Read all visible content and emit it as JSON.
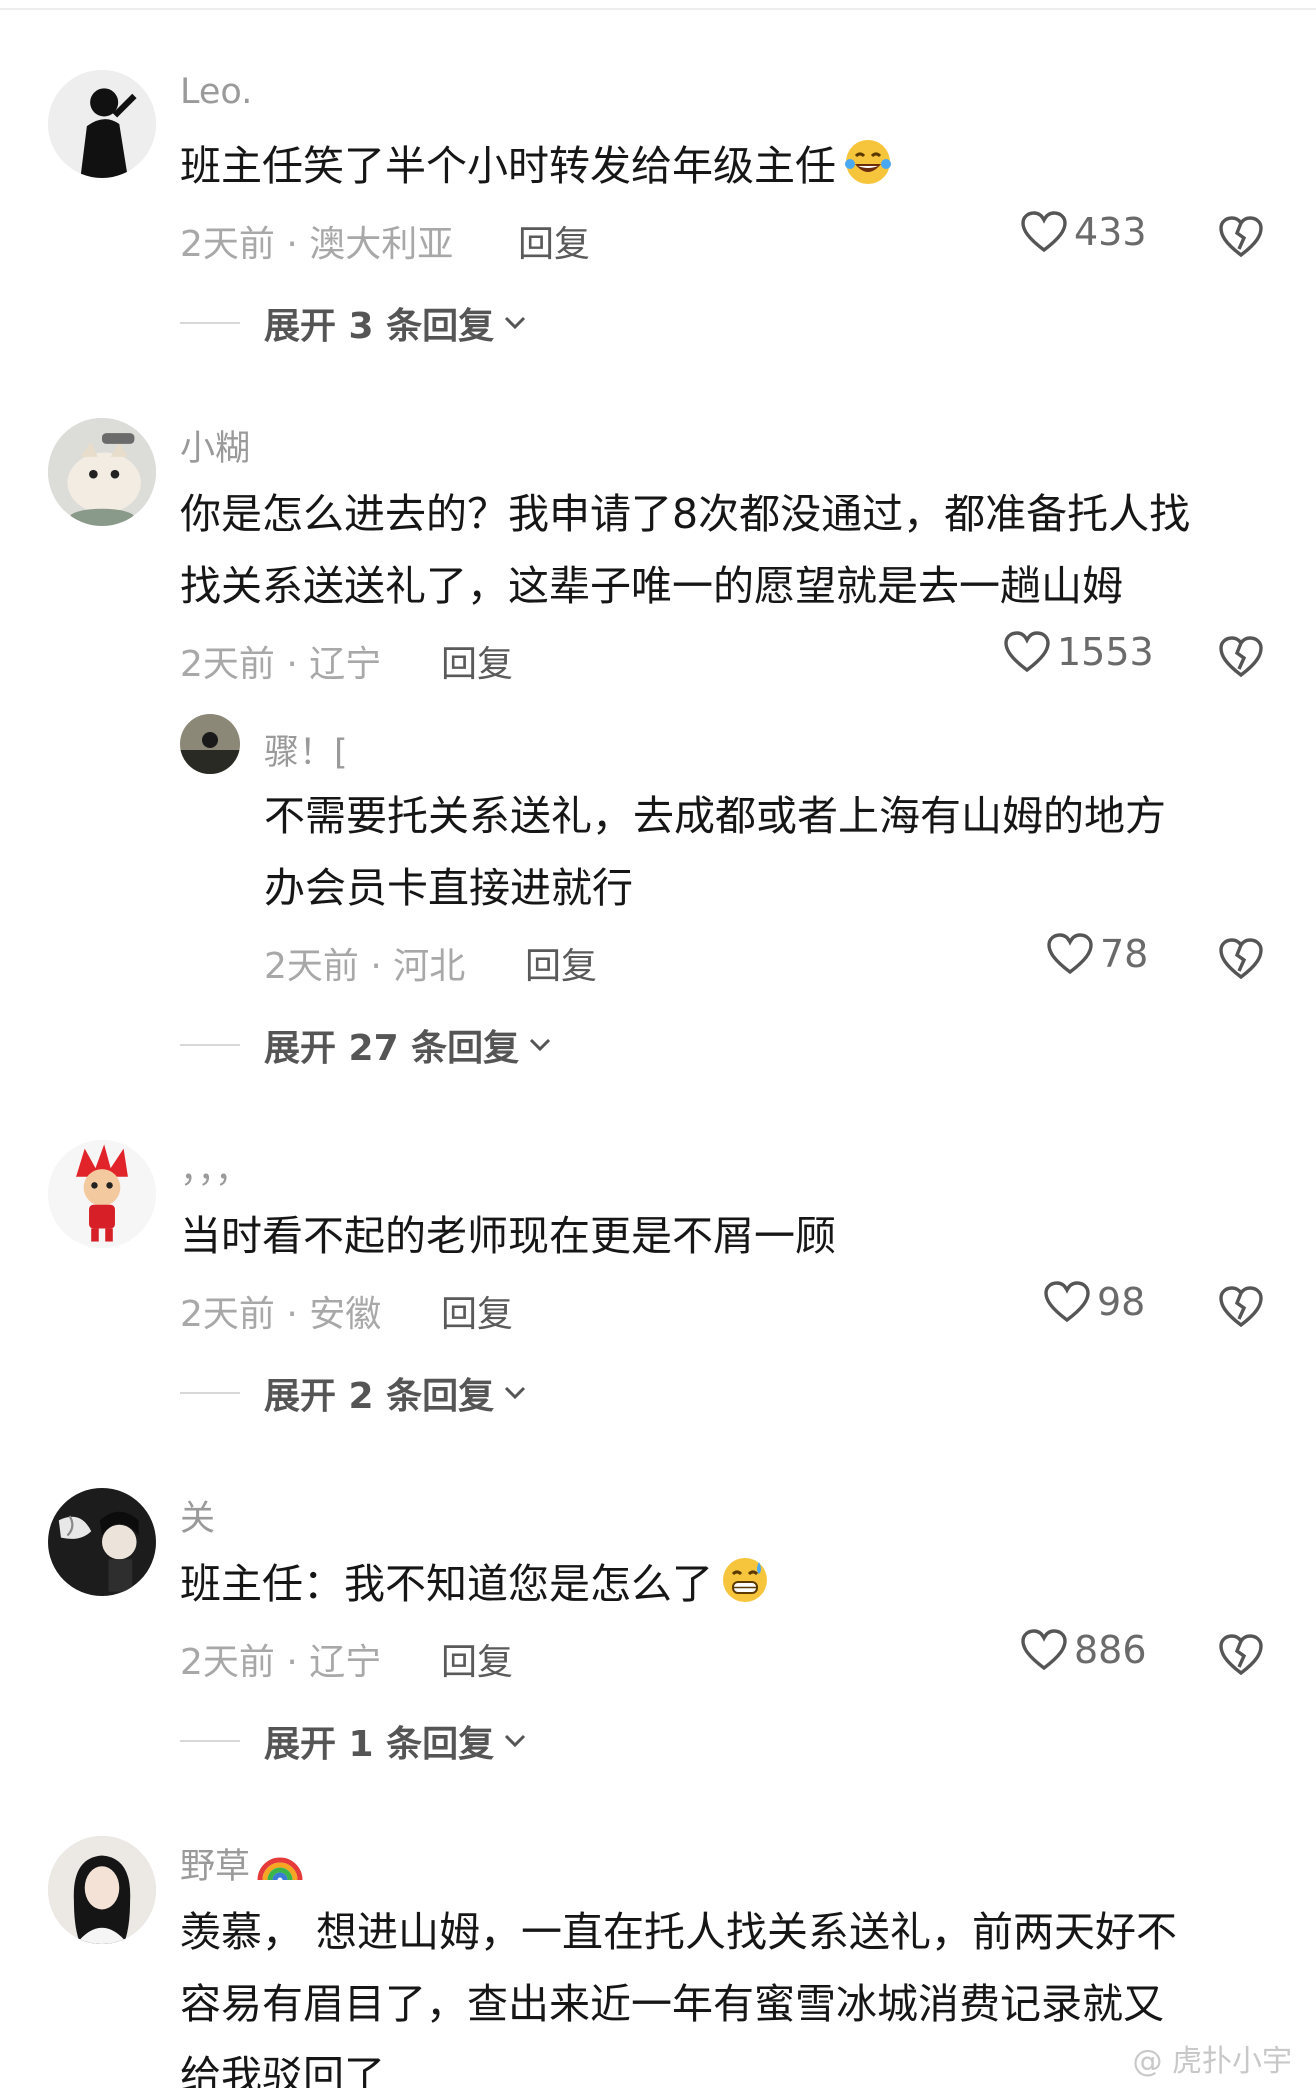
{
  "comments": [
    {
      "username": "Leo.",
      "content_lines": [
        "班主任笑了半个小时转发给年级主任"
      ],
      "emoji": "face-with-tears-of-joy",
      "time_location": "2天前 · 澳大利亚",
      "reply_label": "回复",
      "likes": "433",
      "expand_label": "展开 3 条回复"
    },
    {
      "username": "小糊",
      "content_lines": [
        "你是怎么进去的？我申请了8次都没通过，都准备托人找",
        "找关系送送礼了，这辈子唯一的愿望就是去一趟山姆"
      ],
      "time_location": "2天前 · 辽宁",
      "reply_label": "回复",
      "likes": "1553",
      "sub_reply": {
        "username": "骤！[",
        "content_lines": [
          "不需要托关系送礼，去成都或者上海有山姆的地方",
          "办会员卡直接进就行"
        ],
        "time_location": "2天前 · 河北",
        "reply_label": "回复",
        "likes": "78"
      },
      "expand_label": "展开 27 条回复"
    },
    {
      "username": "，，，",
      "content_lines": [
        "当时看不起的老师现在更是不屑一顾"
      ],
      "time_location": "2天前 · 安徽",
      "reply_label": "回复",
      "likes": "98",
      "expand_label": "展开 2 条回复"
    },
    {
      "username": "关",
      "content_lines": [
        "班主任：我不知道您是怎么了"
      ],
      "emoji": "grinning-face-with-sweat",
      "time_location": "2天前 · 辽宁",
      "reply_label": "回复",
      "likes": "886",
      "expand_label": "展开 1 条回复"
    },
    {
      "username": "野草",
      "username_emoji": "rainbow",
      "content_lines": [
        "羡慕， 想进山姆，一直在托人找关系送礼，前两天好不",
        "容易有眉目了，查出来近一年有蜜雪冰城消费记录就又",
        "给我驳回了"
      ]
    }
  ],
  "watermark": "@ 虎扑小宇",
  "colors": {
    "text": "#161616",
    "meta": "#a8a8a8",
    "username": "#9a9a9a"
  }
}
